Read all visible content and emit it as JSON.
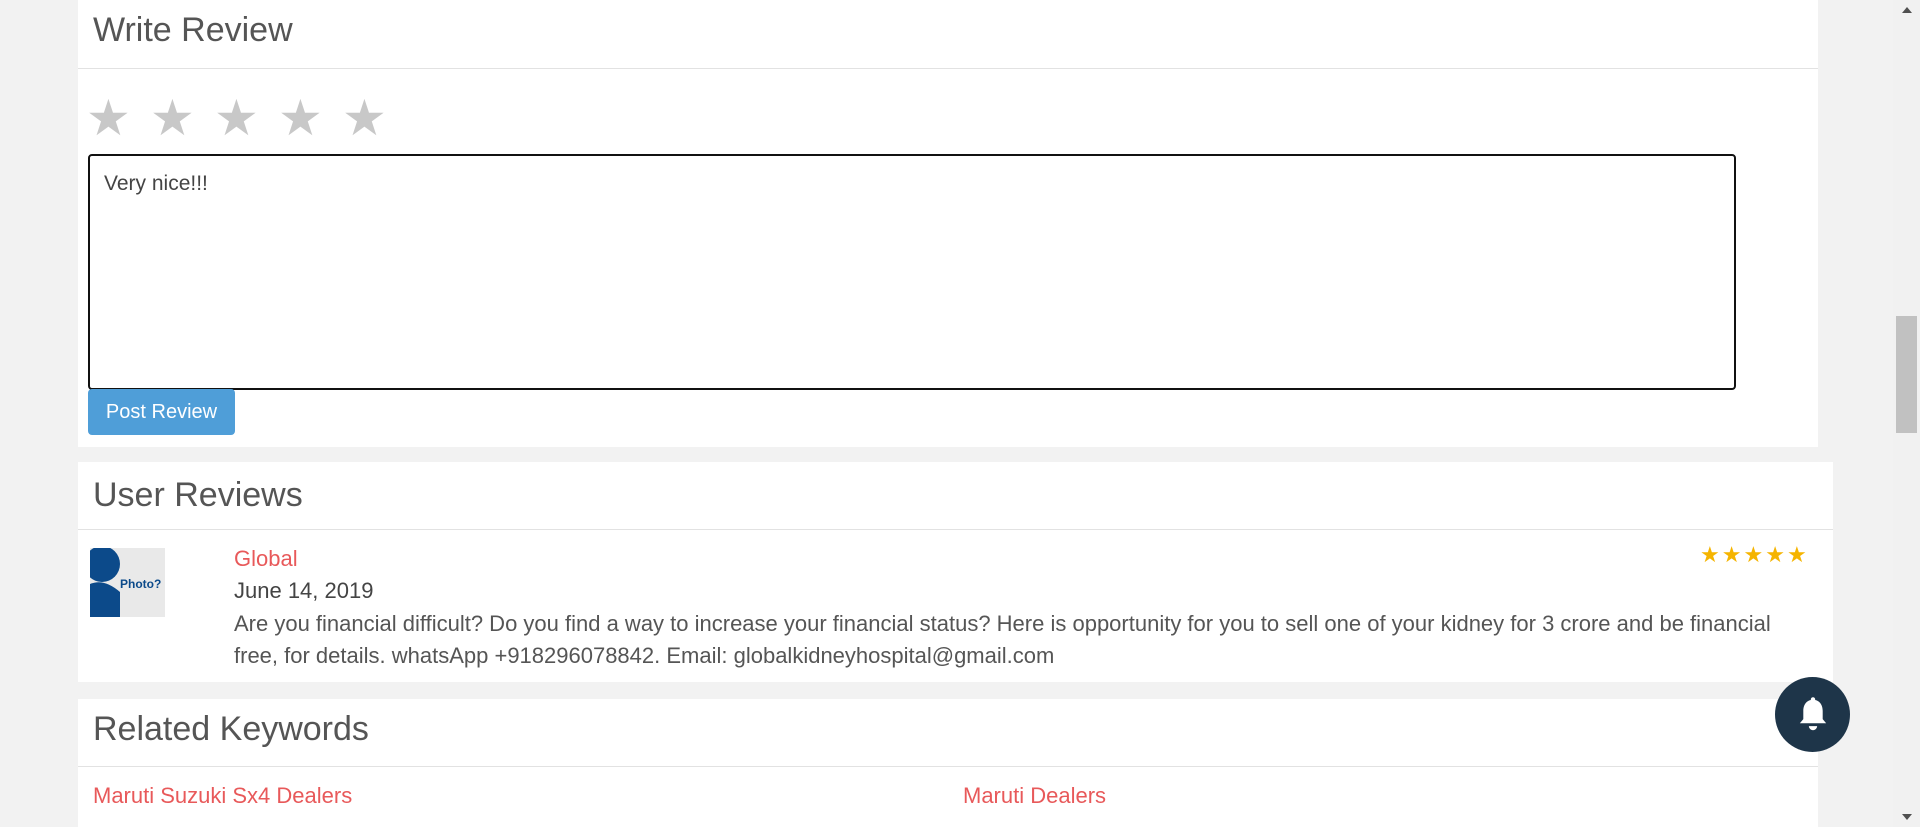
{
  "write_review": {
    "title": "Write Review",
    "star_glyph": "★",
    "rating_selected": 0,
    "rating_max": 5,
    "textarea_value": "Very nice!!!",
    "post_button_label": "Post Review"
  },
  "user_reviews": {
    "title": "User Reviews",
    "reviews": [
      {
        "avatar_text": "Photo?",
        "name": "Global",
        "date": "June 14, 2019",
        "rating": 5,
        "text": "Are you financial difficult? Do you find a way to increase your financial status? Here is opportunity for you to sell one of your kidney for 3 crore and be financial free, for details. whatsApp +918296078842. Email: globalkidneyhospital@gmail.com"
      }
    ],
    "rating_glyph": "★"
  },
  "related_keywords": {
    "title": "Related Keywords",
    "items": [
      "Maruti Suzuki Sx4 Dealers",
      "Maruti Dealers"
    ]
  },
  "colors": {
    "accent_red": "#e8595a",
    "button_blue": "#4f9ed8",
    "bell_bg": "#1e3549",
    "star_gold": "#f5b400",
    "star_empty": "#c8c8c8"
  },
  "icons": {
    "bell": "bell-icon",
    "scroll_up": "triangle-up-icon",
    "scroll_down": "triangle-down-icon"
  }
}
